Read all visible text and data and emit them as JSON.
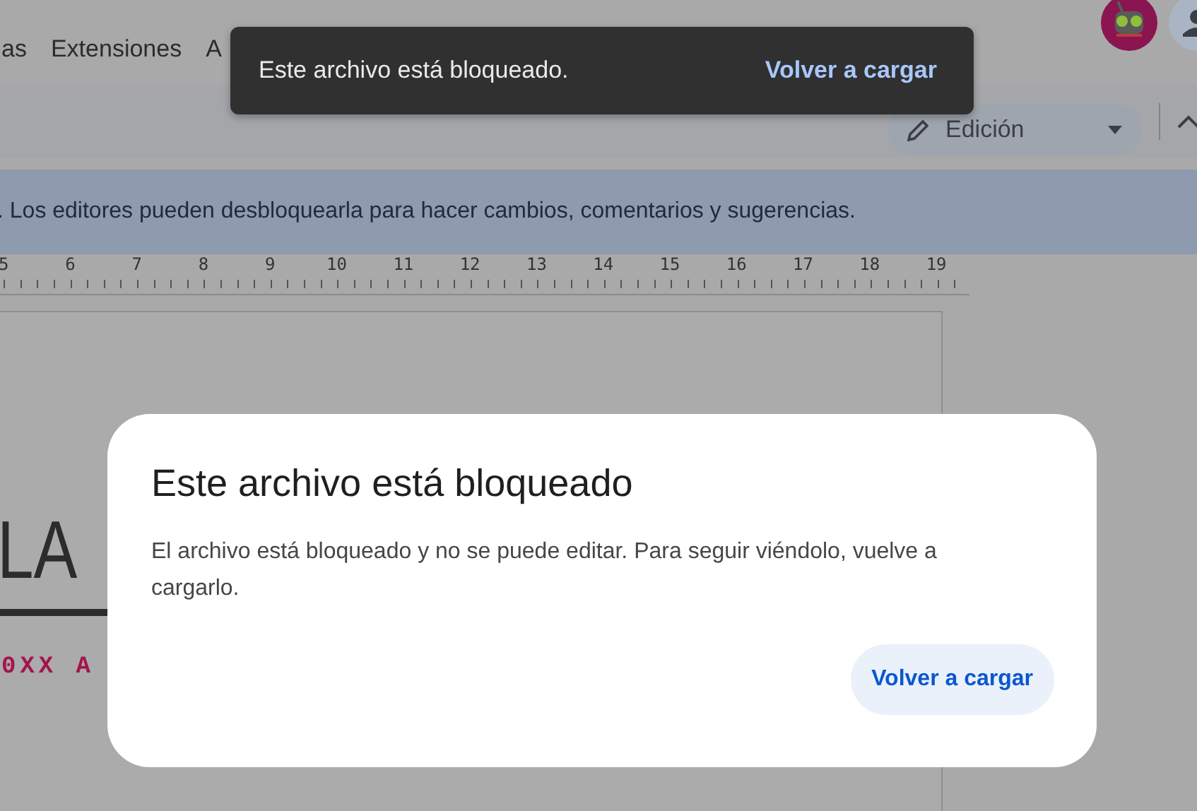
{
  "menu": {
    "items": [
      "as",
      "Extensiones",
      "A"
    ]
  },
  "avatars": [
    {
      "kind": "robot"
    },
    {
      "kind": "person"
    }
  ],
  "mode_button": {
    "label": "Edición"
  },
  "banner": {
    "text": ". Los editores pueden desbloquearla para hacer cambios, comentarios y sugerencias."
  },
  "ruler": {
    "numbers": [
      "5",
      "6",
      "7",
      "8",
      "9",
      "10",
      "11",
      "12",
      "13",
      "14",
      "15",
      "16",
      "17",
      "18",
      "19"
    ]
  },
  "document": {
    "heading": "LA",
    "subtitle": "0XX A"
  },
  "toast": {
    "message": "Este archivo está bloqueado.",
    "action": "Volver a cargar"
  },
  "dialog": {
    "title": "Este archivo está bloqueado",
    "body": "El archivo está bloqueado y no se puede editar. Para seguir viéndolo, vuelve a cargarlo.",
    "button": "Volver a cargar"
  }
}
